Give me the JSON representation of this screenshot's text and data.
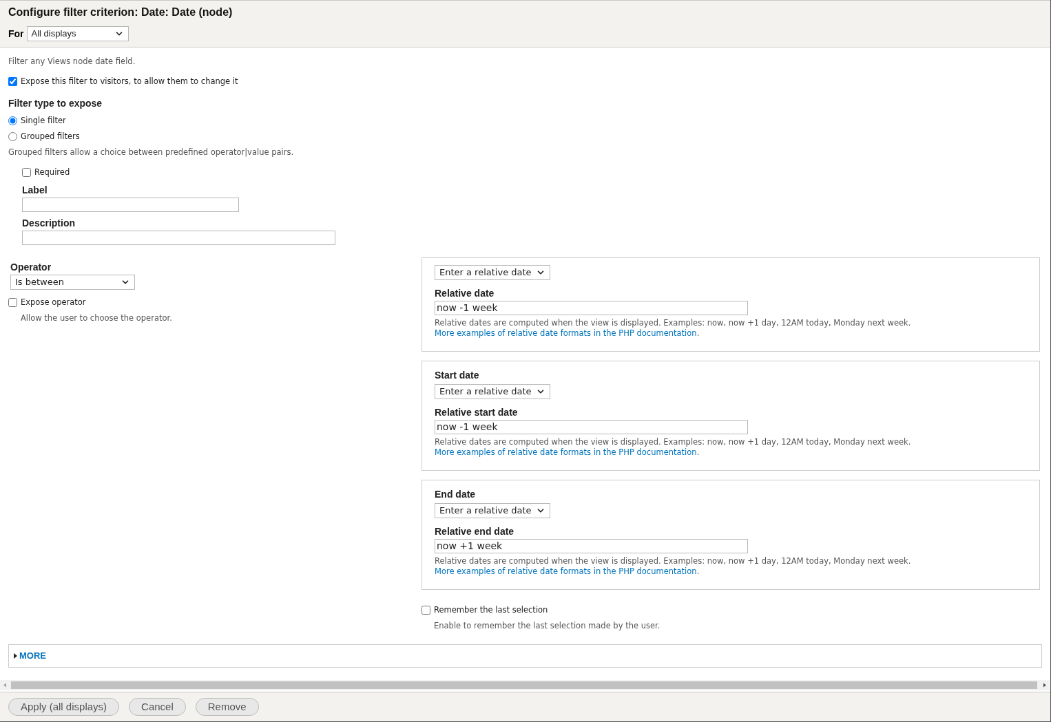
{
  "header": {
    "title": "Configure filter criterion: Date: Date (node)",
    "for_label": "For",
    "for_select": "All displays"
  },
  "intro": "Filter any Views node date field.",
  "expose": {
    "label": "Expose this filter to visitors, to allow them to change it",
    "checked": true
  },
  "filter_type": {
    "heading": "Filter type to expose",
    "options": [
      {
        "label": "Single filter",
        "selected": true
      },
      {
        "label": "Grouped filters",
        "selected": false
      }
    ],
    "help": "Grouped filters allow a choice between predefined operator|value pairs."
  },
  "required": {
    "label": "Required",
    "checked": false
  },
  "label_field": {
    "label": "Label"
  },
  "description_field": {
    "label": "Description"
  },
  "operator": {
    "label": "Operator",
    "value": "Is between"
  },
  "expose_operator": {
    "label": "Expose operator",
    "checked": false,
    "help": "Allow the user to choose the operator."
  },
  "date_groups": [
    {
      "select": "Enter a relative date",
      "field_label": "Relative date",
      "value": "now -1 week",
      "help": "Relative dates are computed when the view is displayed. Examples: now, now +1 day, 12AM today, Monday next week.",
      "link": "More examples of relative date formats in the PHP documentation",
      "link_end": "."
    },
    {
      "heading": "Start date",
      "select": "Enter a relative date",
      "field_label": "Relative start date",
      "value": "now -1 week",
      "help": "Relative dates are computed when the view is displayed. Examples: now, now +1 day, 12AM today, Monday next week.",
      "link": "More examples of relative date formats in the PHP documentation",
      "link_end": "."
    },
    {
      "heading": "End date",
      "select": "Enter a relative date",
      "field_label": "Relative end date",
      "value": "now +1 week",
      "help": "Relative dates are computed when the view is displayed. Examples: now, now +1 day, 12AM today, Monday next week.",
      "link": "More examples of relative date formats in the PHP documentation",
      "link_end": "."
    }
  ],
  "remember": {
    "label": "Remember the last selection",
    "checked": false,
    "help": "Enable to remember the last selection made by the user."
  },
  "more": {
    "label": "MORE",
    "expanded": false
  },
  "buttons": [
    "Apply (all displays)",
    "Cancel",
    "Remove"
  ]
}
